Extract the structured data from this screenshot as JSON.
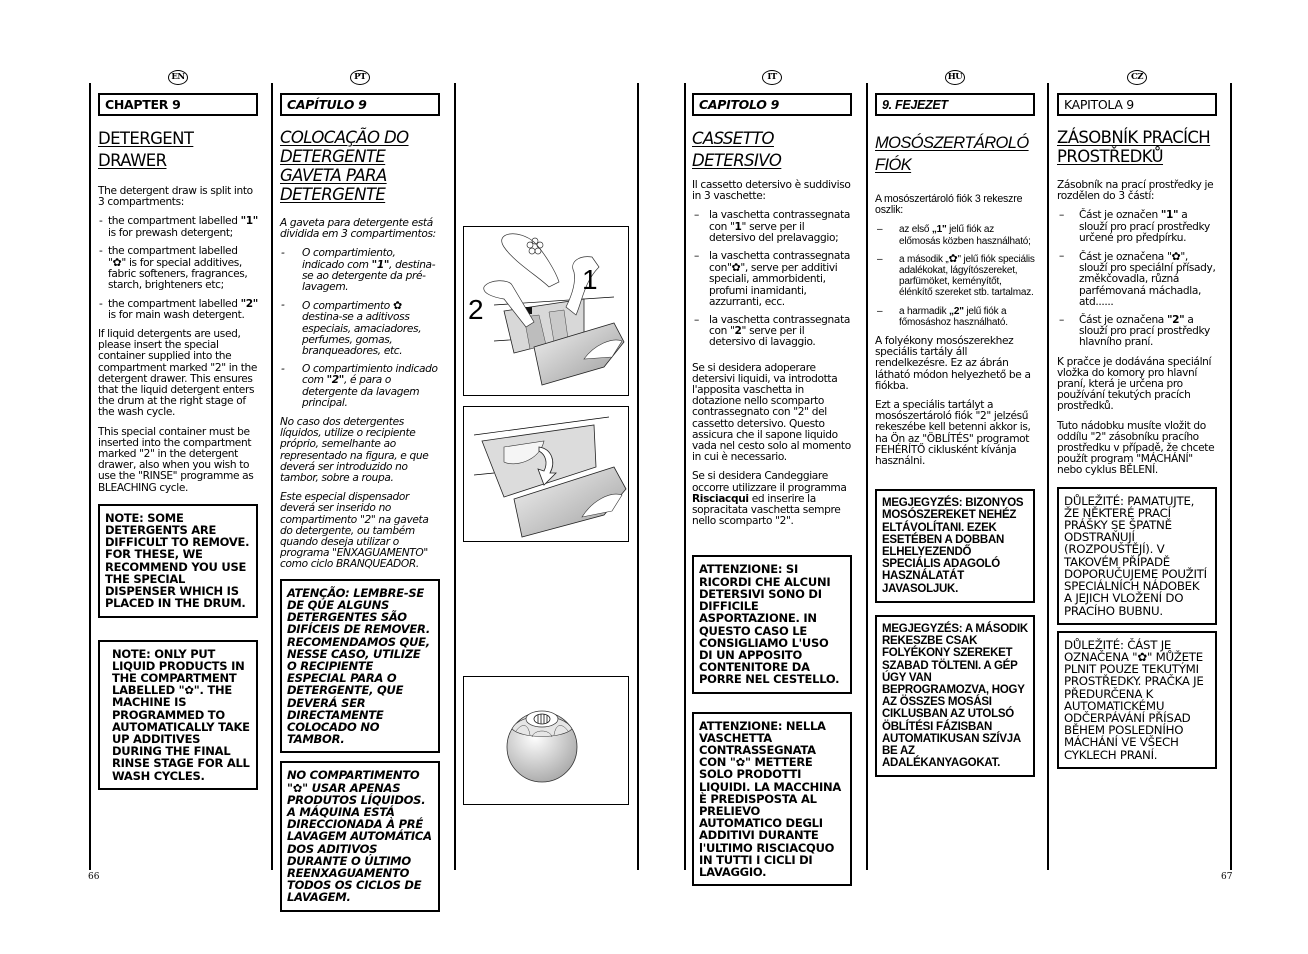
{
  "pages": {
    "left_number": "66",
    "right_number": "67"
  },
  "icons": {
    "flower_symbol": "✿"
  },
  "en": {
    "lang": "EN",
    "chapter": "CHAPTER 9",
    "title_lines": [
      "DETERGENT",
      "DRAWER"
    ],
    "intro": "The detergent draw is split into 3 compartments:",
    "items": [
      {
        "pre": "the compartment labelled ",
        "bold": "\"1\"",
        "post": " is for prewash detergent;"
      },
      {
        "pre": "the compartment labelled \"",
        "symbol": "✿",
        "post": "\" is for special additives, fabric softeners, fragrances, starch, brighteners etc;"
      },
      {
        "pre": "the compartment labelled ",
        "bold": "\"2\"",
        "post": " is for main wash detergent."
      }
    ],
    "para1": "If liquid detergents are used, please insert the special container supplied into the compartment marked \"2\" in the detergent drawer. This ensures that the liquid detergent enters the drum at the right stage of the wash cycle.",
    "para2": "This special container must be inserted into the compartment marked \"2\" in the detergent drawer, also when you wish to use the \"RINSE\" programme as BLEACHING cycle.",
    "note1": "NOTE: SOME DETERGENTS ARE DIFFICULT TO REMOVE. FOR THESE, WE RECOMMEND YOU USE THE SPECIAL DISPENSER WHICH IS PLACED IN THE DRUM.",
    "note2": "NOTE: ONLY PUT LIQUID PRODUCTS IN THE COMPARTMENT LABELLED \"✿\". THE MACHINE IS PROGRAMMED TO AUTOMATICALLY TAKE UP ADDITIVES DURING THE FINAL RINSE STAGE FOR ALL WASH CYCLES."
  },
  "pt": {
    "lang": "PT",
    "chapter": "CAPÍTULO 9",
    "title_lines": [
      "COLOCAÇÃO DO",
      "DETERGENTE",
      "GAVETA PARA",
      "DETERGENTE"
    ],
    "intro": "A gaveta para detergente está dividida em 3 compartimentos:",
    "items": [
      {
        "pre": "O compartimiento, indicado com ",
        "bold": "\"1\"",
        "post": ", destina-se ao detergente da pré-lavagem."
      },
      {
        "pre": "O compartimento ",
        "symbol": "✿",
        "post": " destina-se a aditivoss especiais, amaciadores, perfumes, gomas, branqueadores, etc."
      },
      {
        "pre": "O compartimiento indicado com ",
        "bold": "\"2\"",
        "post": ", é para o detergente da lavagem principal."
      }
    ],
    "para1": "No caso dos detergentes líquidos, utilize o recipiente próprio, semelhante ao representado na figura, e que deverá ser introduzido no tambor, sobre a roupa.",
    "para2": "Este especial dispensador deverá ser inserido no compartimento \"2\" na gaveta do detergente, ou também quando deseja utilizar o programa \"ENXAGUAMENTO\" como ciclo BRANQUEADOR.",
    "note1": "ATENÇÃO: LEMBRE-SE DE QUE ALGUNS DETERGENTES SÃO DIFÍCEIS DE REMOVER. RECOMENDAMOS QUE, NESSE CASO, UTILIZE O RECIPIENTE ESPECIAL PARA O DETERGENTE, QUE DEVERÁ SER DIRECTAMENTE COLOCADO NO TAMBOR.",
    "note2": "NO COMPARTIMENTO \"✿\" USAR APENAS PRODUTOS LÍQUIDOS. A MÁQUINA ESTÁ DIRECCIONADA À PRÉ LAVAGEM AUTOMÁTICA DOS ADITIVOS DURANTE O ÚLTIMO REENXAGUAMENTO TODOS OS CICLOS DE LAVAGEM."
  },
  "figures": {
    "fig1_labels": {
      "one": "1",
      "two": "2"
    }
  },
  "it": {
    "lang": "IT",
    "chapter": "CAPITOLO 9",
    "title_lines": [
      "CASSETTO DETERSIVO"
    ],
    "intro": "Il cassetto detersivo è suddiviso in 3 vaschette:",
    "items": [
      {
        "pre": "la vaschetta contrassegnata con \"",
        "bold": "1",
        "post": "\" serve per il detersivo del prelavaggio;"
      },
      {
        "pre": "la vaschetta contrassegnata con\"",
        "symbol": "✿",
        "post": "\", serve per additivi speciali, ammorbidenti, profumi inamidanti, azzurranti, ecc."
      },
      {
        "pre": "la vaschetta contrassegnata con \"",
        "bold": "2",
        "post": "\" serve per il detersivo di lavaggio."
      }
    ],
    "para1": "Se si desidera adoperare detersivi liquidi, va introdotta l'apposita vaschetta in dotazione nello scomparto contrassegnato con \"2\" del cassetto detersivo. Questo assicura che il sapone liquido vada nel cesto solo al momento in cui è necessario.",
    "para2_pre": "Se si desidera Candeggiare occorre utilizzare il programma ",
    "para2_bold": "Risciacqui",
    "para2_post": " ed inserire la sopracitata vaschetta sempre nello scomparto \"2\".",
    "note1": "ATTENZIONE: SI RICORDI CHE ALCUNI DETERSIVI SONO DI DIFFICILE ASPORTAZIONE. IN QUESTO CASO LE CONSIGLIAMO L'USO DI UN APPOSITO CONTENITORE DA PORRE NEL CESTELLO.",
    "note2": "ATTENZIONE: NELLA VASCHETTA CONTRASSEGNATA CON \"✿\" METTERE SOLO PRODOTTI LIQUIDI. LA MACCHINA È PREDISPOSTA AL PRELIEVO AUTOMATICO DEGLI ADDITIVI DURANTE l'ULTIMO RISCIACQUO IN TUTTI I CICLI DI LAVAGGIO."
  },
  "hu": {
    "lang": "HU",
    "chapter": "9. FEJEZET",
    "title_lines": [
      "MOSÓSZERTÁROLÓ",
      "FIÓK"
    ],
    "intro": "A mosószertároló fiók 3 rekeszre oszlik:",
    "items": [
      {
        "pre": "az első ",
        "bold": "„1\"",
        "post": " jelű fiók az előmosás közben használható;"
      },
      {
        "pre": "a második „",
        "symbol": "✿",
        "post": "\" jelű fiók speciális adalékokat, lágyítószereket, parfümöket, keményítőt, élénkítő szereket stb. tartalmaz."
      },
      {
        "pre": "a harmadik ",
        "bold": "„2\"",
        "post": " jelű fiók a főmosáshoz használható."
      }
    ],
    "para1": "A folyékony mosószerekhez speciális tartály áll rendelkezésre. Ez az ábrán látható módon helyezhető be a fiókba.",
    "para2": "Ezt a speciális tartályt a mosószertároló fiók \"2\" jelzésű rekeszébe kell betenni akkor is, ha Ön az \"ÖBLÍTÉS\" programot FEHÉRÍTŐ ciklusként kívánja használni.",
    "note1": "MEGJEGYZÉS: BIZONYOS MOSÓSZEREKET NEHÉZ ELTÁVOLÍTANI. EZEK ESETÉBEN A DOBBAN ELHELYEZENDŐ SPECIÁLIS ADAGOLÓ HASZNÁLATÁT JAVASOLJUK.",
    "note2": "MEGJEGYZÉS: A MÁSODIK REKESZBE CSAK FOLYÉKONY SZEREKET SZABAD TÖLTENI. A GÉP ÚGY VAN BEPROGRAMOZVA, HOGY AZ ÖSSZES MOSÁSI CIKLUSBAN AZ UTOLSÓ ÖBLÍTÉSI FÁZISBAN AUTOMATIKUSAN SZÍVJA BE AZ ADALÉKANYAGOKAT."
  },
  "cz": {
    "lang": "CZ",
    "chapter": "KAPITOLA 9",
    "title_lines": [
      "ZÁSOBNÍK PRACÍCH",
      "PROSTŘEDKŮ"
    ],
    "intro": "Zásobník na prací prostředky je rozdělen do 3 částí:",
    "items": [
      {
        "pre": "Část je označen ",
        "bold": "\"1\"",
        "post": " a slouží pro prací prostředky určené pro předpírku."
      },
      {
        "pre": "Část je označena \"",
        "symbol": "✿",
        "post": "\", slouží pro speciální přísady, změkčovadla, různá parfémovaná máchadla, atd......"
      },
      {
        "pre": "Část je označena ",
        "bold": "\"2\"",
        "post": " a slouží pro prací prostředky hlavního praní."
      }
    ],
    "para1": "K pračce je dodávána speciální vložka do komory pro hlavní praní, která je určena pro používání tekutých pracích prostředků.",
    "para2": "Tuto nádobku musíte vložit do oddílu \"2\" zásobníku pracího prostředku v případě, že chcete použít program \"MÁCHÁNÍ\" nebo cyklus BĚLENÍ.",
    "note1": "DŮLEŽITÉ: PAMATUJTE, ŽE NĚKTERÉ PRACÍ PRÁŠKY SE ŠPATNĚ ODSTRAŇUJÍ (ROZPOUŠTĚJÍ). V TAKOVÉM PŘÍPADĚ DOPORUČUJEME POUŽITÍ SPECIÁLNÍCH NÁDOBEK A JEJICH VLOŽENÍ DO PRACÍHO BUBNU.",
    "note2": "DŮLEŽITÉ: ČÁST JE OZNAČENA \"✿\" MŮŽETE PLNIT POUZE TEKUTÝMI PROSTŘEDKY. PRAČKA JE PŘEDURČENA K AUTOMATICKÉMU ODČERPÁVÁNÍ PŘÍSAD BĚHEM POSLEDNÍHO MÁCHÁNÍ VE VŠECH CYKLECH PRANÍ."
  }
}
